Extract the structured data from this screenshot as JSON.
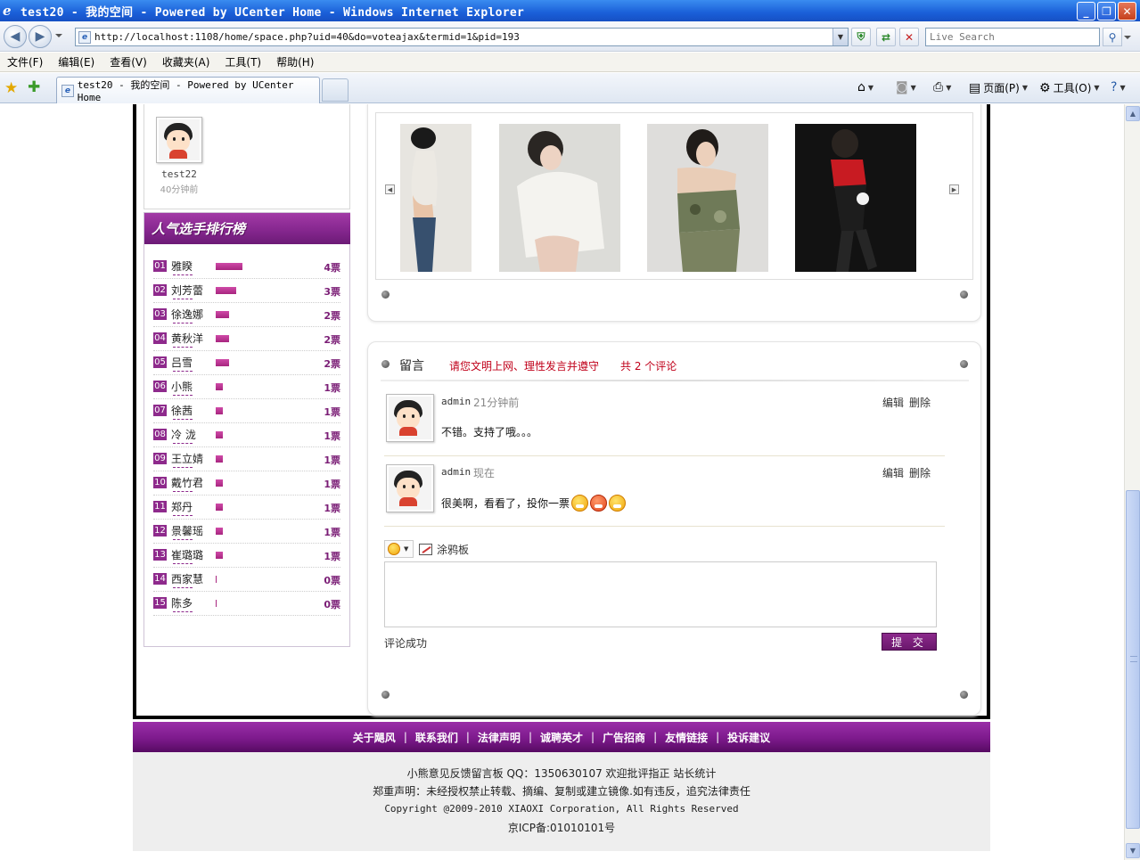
{
  "window": {
    "title": "test20 - 我的空间 - Powered by UCenter Home - Windows Internet Explorer",
    "buttons": [
      "minimize",
      "maximize",
      "close"
    ]
  },
  "address_bar": {
    "url": "http://localhost:1108/home/space.php?uid=40&do=voteajax&termid=1&pid=193",
    "search_placeholder": "Live Search"
  },
  "menu": [
    "文件(F)",
    "编辑(E)",
    "查看(V)",
    "收藏夹(A)",
    "工具(T)",
    "帮助(H)"
  ],
  "tabs": [
    {
      "label": "test20 - 我的空间 - Powered by UCenter Home"
    }
  ],
  "command_bar": {
    "page_label": "页面(P)",
    "tools_label": "工具(O)"
  },
  "sidebar": {
    "user": {
      "name": "test22",
      "time": "40分钟前"
    },
    "ranking": {
      "title": "人气选手排行榜",
      "items": [
        {
          "rank": "01",
          "name": "雅睽",
          "votes": "4票",
          "value": 4
        },
        {
          "rank": "02",
          "name": "刘芳蕾",
          "votes": "3票",
          "value": 3
        },
        {
          "rank": "03",
          "name": "徐逸娜",
          "votes": "2票",
          "value": 2
        },
        {
          "rank": "04",
          "name": "黄秋洋",
          "votes": "2票",
          "value": 2
        },
        {
          "rank": "05",
          "name": "吕雪",
          "votes": "2票",
          "value": 2
        },
        {
          "rank": "06",
          "name": "小熊",
          "votes": "1票",
          "value": 1
        },
        {
          "rank": "07",
          "name": "徐茜",
          "votes": "1票",
          "value": 1
        },
        {
          "rank": "08",
          "name": "冷 泷",
          "votes": "1票",
          "value": 1
        },
        {
          "rank": "09",
          "name": "王立婧",
          "votes": "1票",
          "value": 1
        },
        {
          "rank": "10",
          "name": "戴竹君",
          "votes": "1票",
          "value": 1
        },
        {
          "rank": "11",
          "name": "郑丹",
          "votes": "1票",
          "value": 1
        },
        {
          "rank": "12",
          "name": "景馨瑶",
          "votes": "1票",
          "value": 1
        },
        {
          "rank": "13",
          "name": "崔璐璐",
          "votes": "1票",
          "value": 1
        },
        {
          "rank": "14",
          "name": "西家慧",
          "votes": "0票",
          "value": 0
        },
        {
          "rank": "15",
          "name": "陈多",
          "votes": "0票",
          "value": 0
        }
      ]
    }
  },
  "comments": {
    "label": "留言",
    "notice": "请您文明上网、理性发言并遵守",
    "count_text": "共 2 个评论",
    "items": [
      {
        "author": "admin",
        "time": "21分钟前",
        "text": "不错。支持了哦。。。",
        "edit": "编辑",
        "delete": "删除",
        "emoticons": []
      },
      {
        "author": "admin",
        "time": "现在",
        "text": "很美啊，看看了，投你一票",
        "edit": "编辑",
        "delete": "删除",
        "emoticons": [
          "grin-icon",
          "angry-icon",
          "laugh-icon"
        ]
      }
    ],
    "doodle_label": "涂鸦板",
    "status": "评论成功",
    "submit_label": "提 交"
  },
  "footer": {
    "links": [
      "关于飓风",
      "联系我们",
      "法律声明",
      "诚聘英才",
      "广告招商",
      "友情链接",
      "投诉建议"
    ],
    "line1": "小熊意见反馈留言板    QQ：1350630107   欢迎批评指正 站长统计",
    "line2": "郑重声明：未经授权禁止转载、摘编、复制或建立镜像.如有违反，追究法律责任",
    "line3": "Copyright @2009-2010 XIAOXI Corporation, All Rights Reserved",
    "line4": "京ICP备:01010101号"
  }
}
